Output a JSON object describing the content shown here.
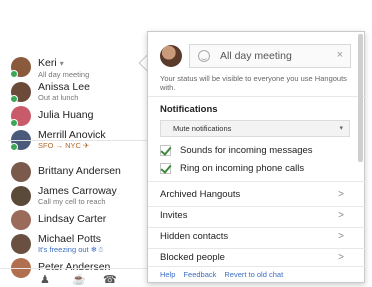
{
  "contacts": [
    {
      "name": "Keri",
      "status": "All day meeting",
      "online": true,
      "me": true,
      "avatar_color": "#8a5a3c"
    },
    {
      "name": "Anissa Lee",
      "status": "Out at lunch",
      "online": true,
      "avatar_color": "#6b4a3a"
    },
    {
      "name": "Julia Huang",
      "status": "",
      "online": true,
      "avatar_color": "#c85a6a"
    },
    {
      "name": "Merrill Anovick",
      "status": "SFO → NYC ✈",
      "online": true,
      "avatar_color": "#4a5a7a"
    },
    {
      "name": "Brittany Andersen",
      "status": "",
      "online": false,
      "avatar_color": "#7a5a4a"
    },
    {
      "name": "James Carroway",
      "status": "Call my cell to reach",
      "online": false,
      "avatar_color": "#5a4a3a"
    },
    {
      "name": "Lindsay Carter",
      "status": "",
      "online": false,
      "avatar_color": "#9a6a5a"
    },
    {
      "name": "Michael Potts",
      "status": "It's freezing out ❄☃",
      "online": false,
      "avatar_color": "#6a5040"
    },
    {
      "name": "Peter Andersen",
      "status": "",
      "online": false,
      "avatar_color": "#b07050"
    }
  ],
  "me_caret": "▾",
  "bottom_icons": {
    "contacts": "♟",
    "chat": "☕",
    "phone": "☎"
  },
  "panel": {
    "status_value": "All day meeting",
    "clear_icon": "×",
    "description": "Your status will be visible to everyone you use Hangouts with.",
    "notifications_title": "Notifications",
    "mute_label": "Mute notifications",
    "mute_caret": "▾",
    "checkboxes": [
      {
        "label": "Sounds for incoming messages",
        "checked": true
      },
      {
        "label": "Ring on incoming phone calls",
        "checked": true
      }
    ],
    "menu_items": [
      {
        "label": "Archived Hangouts"
      },
      {
        "label": "Invites"
      },
      {
        "label": "Hidden contacts"
      },
      {
        "label": "Blocked people"
      }
    ],
    "chevron": ">",
    "footer": {
      "help": "Help",
      "feedback": "Feedback",
      "revert": "Revert to old chat"
    }
  }
}
